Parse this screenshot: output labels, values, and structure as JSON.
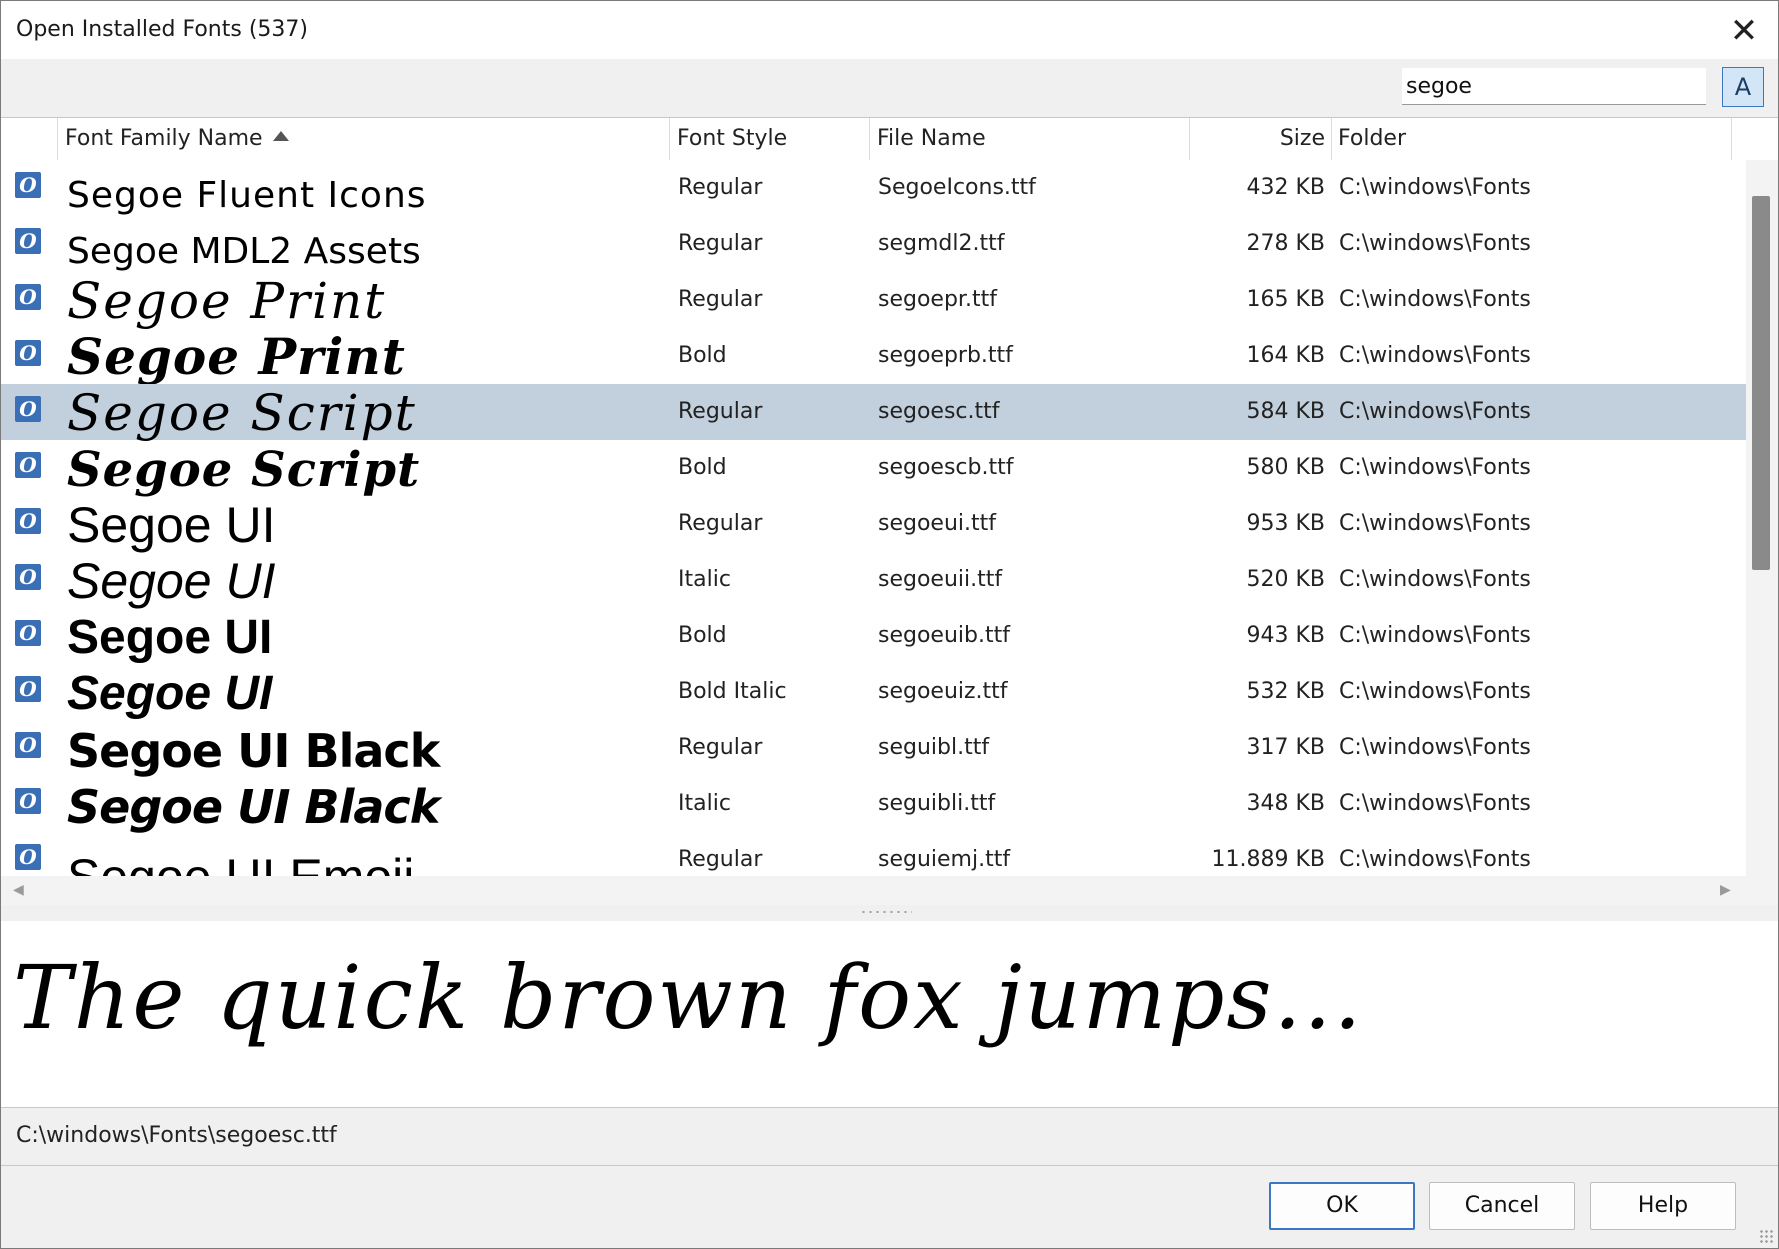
{
  "window": {
    "title": "Open Installed Fonts (537)"
  },
  "search": {
    "value": "segoe",
    "toggle_label": "A"
  },
  "columns": [
    {
      "label": "Font Family Name"
    },
    {
      "label": "Font Style"
    },
    {
      "label": "File Name"
    },
    {
      "label": "Size"
    },
    {
      "label": "Folder"
    }
  ],
  "sort": {
    "column": "Font Family Name",
    "direction": "ascending"
  },
  "rows": [
    {
      "family": "Segoe Fluent Icons",
      "style": "Regular",
      "file": "SegoeIcons.ttf",
      "size": "432 KB",
      "folder": "C:\\windows\\Fonts",
      "selected": false
    },
    {
      "family": "Segoe MDL2 Assets",
      "style": "Regular",
      "file": "segmdl2.ttf",
      "size": "278 KB",
      "folder": "C:\\windows\\Fonts",
      "selected": false
    },
    {
      "family": "Segoe Print",
      "style": "Regular",
      "file": "segoepr.ttf",
      "size": "165 KB",
      "folder": "C:\\windows\\Fonts",
      "selected": false
    },
    {
      "family": "Segoe Print",
      "style": "Bold",
      "file": "segoeprb.ttf",
      "size": "164 KB",
      "folder": "C:\\windows\\Fonts",
      "selected": false
    },
    {
      "family": "Segoe Script",
      "style": "Regular",
      "file": "segoesc.ttf",
      "size": "584 KB",
      "folder": "C:\\windows\\Fonts",
      "selected": true
    },
    {
      "family": "Segoe Script",
      "style": "Bold",
      "file": "segoescb.ttf",
      "size": "580 KB",
      "folder": "C:\\windows\\Fonts",
      "selected": false
    },
    {
      "family": "Segoe UI",
      "style": "Regular",
      "file": "segoeui.ttf",
      "size": "953 KB",
      "folder": "C:\\windows\\Fonts",
      "selected": false
    },
    {
      "family": "Segoe UI",
      "style": "Italic",
      "file": "segoeuii.ttf",
      "size": "520 KB",
      "folder": "C:\\windows\\Fonts",
      "selected": false
    },
    {
      "family": "Segoe UI",
      "style": "Bold",
      "file": "segoeuib.ttf",
      "size": "943 KB",
      "folder": "C:\\windows\\Fonts",
      "selected": false
    },
    {
      "family": "Segoe UI",
      "style": "Bold Italic",
      "file": "segoeuiz.ttf",
      "size": "532 KB",
      "folder": "C:\\windows\\Fonts",
      "selected": false
    },
    {
      "family": "Segoe UI Black",
      "style": "Regular",
      "file": "seguibl.ttf",
      "size": "317 KB",
      "folder": "C:\\windows\\Fonts",
      "selected": false
    },
    {
      "family": "Segoe UI Black",
      "style": "Italic",
      "file": "seguibli.ttf",
      "size": "348 KB",
      "folder": "C:\\windows\\Fonts",
      "selected": false
    },
    {
      "family": "Segoe UI Emoji",
      "style": "Regular",
      "file": "seguiemj.ttf",
      "size": "11.889 KB",
      "folder": "C:\\windows\\Fonts",
      "selected": false
    }
  ],
  "preview": {
    "text": "The quick brown fox jumps..."
  },
  "path": {
    "text": "C:\\windows\\Fonts\\segoesc.ttf"
  },
  "buttons": {
    "ok": "OK",
    "cancel": "Cancel",
    "help": "Help"
  },
  "icons": {
    "close": "close-icon",
    "font_file": "opentype-font-icon",
    "sort": "sort-ascending-icon"
  },
  "colors": {
    "selection": "#c2cfdc",
    "accent": "#3a78c3",
    "font_icon": "#3a6eb5"
  }
}
